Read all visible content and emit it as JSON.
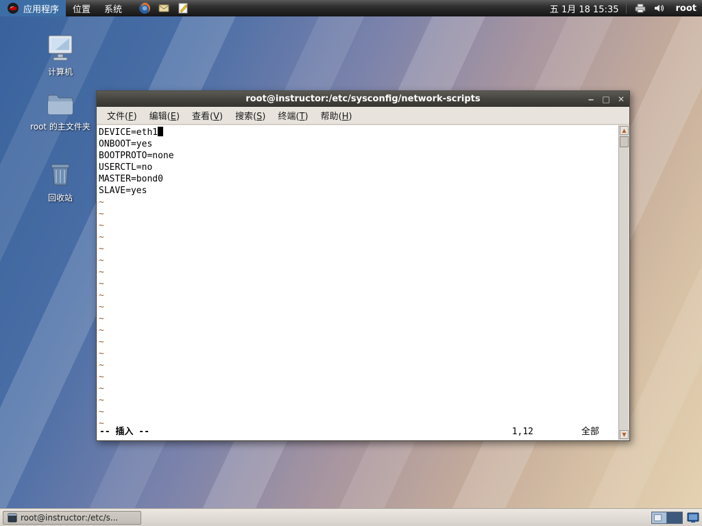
{
  "panel": {
    "menus": [
      {
        "label": "应用程序"
      },
      {
        "label": "位置"
      },
      {
        "label": "系统"
      }
    ],
    "launcher_icons": [
      "firefox-icon",
      "mail-icon",
      "gedit-icon"
    ],
    "clock": "五 1月 18 15:35",
    "status_icons": [
      "printer-icon",
      "volume-icon"
    ],
    "user": "root"
  },
  "desktop": {
    "icons": [
      {
        "label": "计算机"
      },
      {
        "label": "root 的主文件夹"
      },
      {
        "label": "回收站"
      }
    ]
  },
  "window": {
    "title": "root@instructor:/etc/sysconfig/network-scripts",
    "controls": {
      "minimize": "‒",
      "maximize": "□",
      "close": "✕"
    },
    "menu": [
      {
        "pre": "文件(",
        "key": "F",
        "post": ")"
      },
      {
        "pre": "编辑(",
        "key": "E",
        "post": ")"
      },
      {
        "pre": "查看(",
        "key": "V",
        "post": ")"
      },
      {
        "pre": "搜索(",
        "key": "S",
        "post": ")"
      },
      {
        "pre": "终端(",
        "key": "T",
        "post": ")"
      },
      {
        "pre": "帮助(",
        "key": "H",
        "post": ")"
      }
    ],
    "lines": [
      "DEVICE=eth1",
      "ONBOOT=yes",
      "BOOTPROTO=none",
      "USERCTL=no",
      "MASTER=bond0",
      "SLAVE=yes"
    ],
    "cursor_line": 0,
    "tilde_char": "~",
    "tilde_count": 20,
    "status": {
      "mode": "-- 插入 --",
      "position": "1,12",
      "scroll": "全部"
    }
  },
  "taskbar": {
    "task_label": "root@instructor:/etc/s..."
  },
  "colors": {
    "tilde": "#9a5a2e",
    "panel_bg": "#2f2f2f",
    "titlebar_bg": "#45443f",
    "desktop_blue": "#39629c",
    "desktop_tan": "#e4d2b2"
  }
}
